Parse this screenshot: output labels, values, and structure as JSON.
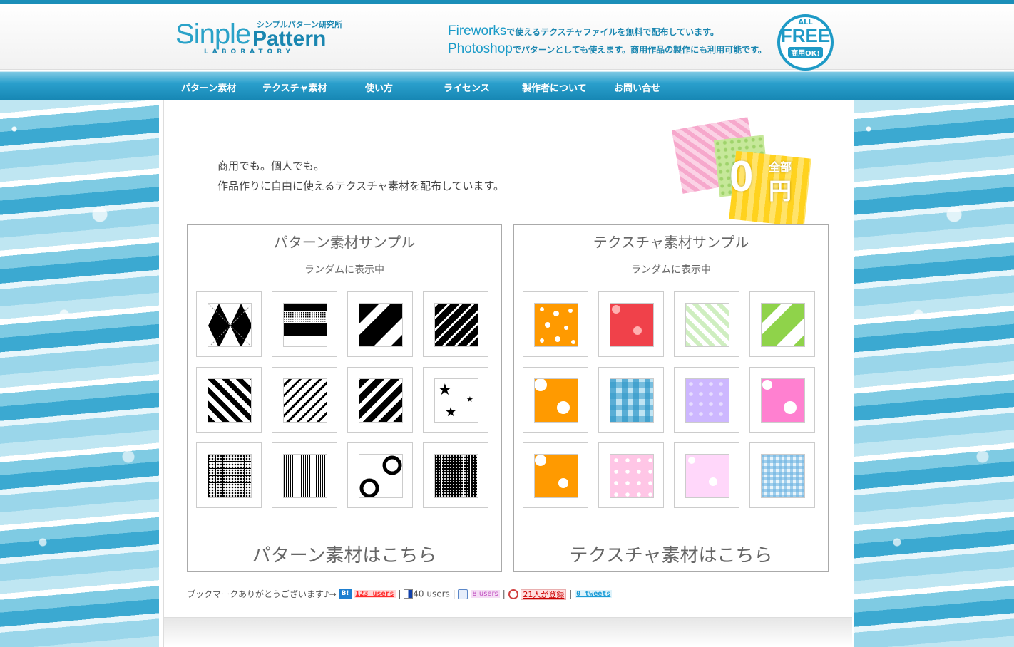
{
  "header": {
    "logo_sinple": "Sinple",
    "logo_pattern": "Pattern",
    "logo_jp": "シンプルパターン研究所",
    "logo_lab": "LABORATORY",
    "tagline1_big": "Fireworks",
    "tagline1_small": "で使えるテクスチャファイルを無料で配布しています。",
    "tagline2_big": "Photoshop",
    "tagline2_small": "でパターンとしても使えます。商用作品の製作にも利用可能です。",
    "badge_all": "ALL",
    "badge_free": "FREE",
    "badge_ok": "商用OK!"
  },
  "nav": {
    "items": [
      {
        "label": "パターン素材"
      },
      {
        "label": "テクスチャ素材"
      },
      {
        "label": "使い方"
      },
      {
        "label": "ライセンス"
      },
      {
        "label": "製作者について"
      },
      {
        "label": "お問い合せ"
      }
    ]
  },
  "intro": {
    "line1": "商用でも。個人でも。",
    "line2": "作品作りに自由に使えるテクスチャ素材を配布しています。"
  },
  "zero_badge": {
    "zero": "0",
    "zenbu": "全部",
    "en": "円"
  },
  "pattern_panel": {
    "title": "パターン素材サンプル",
    "subtitle": "ランダムに表示中",
    "link": "パターン素材はこちら",
    "tiles": [
      "argyle",
      "halftone-bands",
      "single-diagonal",
      "thin-diagonal-lines",
      "thick-diagonal-stripes",
      "diagonal-lines",
      "bold-diagonal-stripes",
      "stars",
      "dot-grid",
      "fine-grid",
      "circles",
      "black-grid"
    ]
  },
  "texture_panel": {
    "title": "テクスチャ素材サンプル",
    "subtitle": "ランダムに表示中",
    "link": "テクスチャ素材はこちら",
    "tiles": [
      "orange-dots",
      "red-dots",
      "green-check",
      "green-stripe",
      "orange-big-dots",
      "blue-plaid",
      "purple-dots",
      "pink-big-dots",
      "orange-big-dots-2",
      "pink-small-dots",
      "pink-dots",
      "blue-gingham"
    ]
  },
  "bookmark": {
    "text": "ブックマークありがとうございます♪→",
    "hatena_icon": "B!",
    "hatena_count": "123 users",
    "delicious_count": "40 users",
    "clip_count": "8 users",
    "livedoor_count": "21人が登録",
    "tweet_count": "0 tweets",
    "separator": "|"
  },
  "colors": {
    "accent": "#1a9bc8",
    "nav": "#1686b3"
  }
}
